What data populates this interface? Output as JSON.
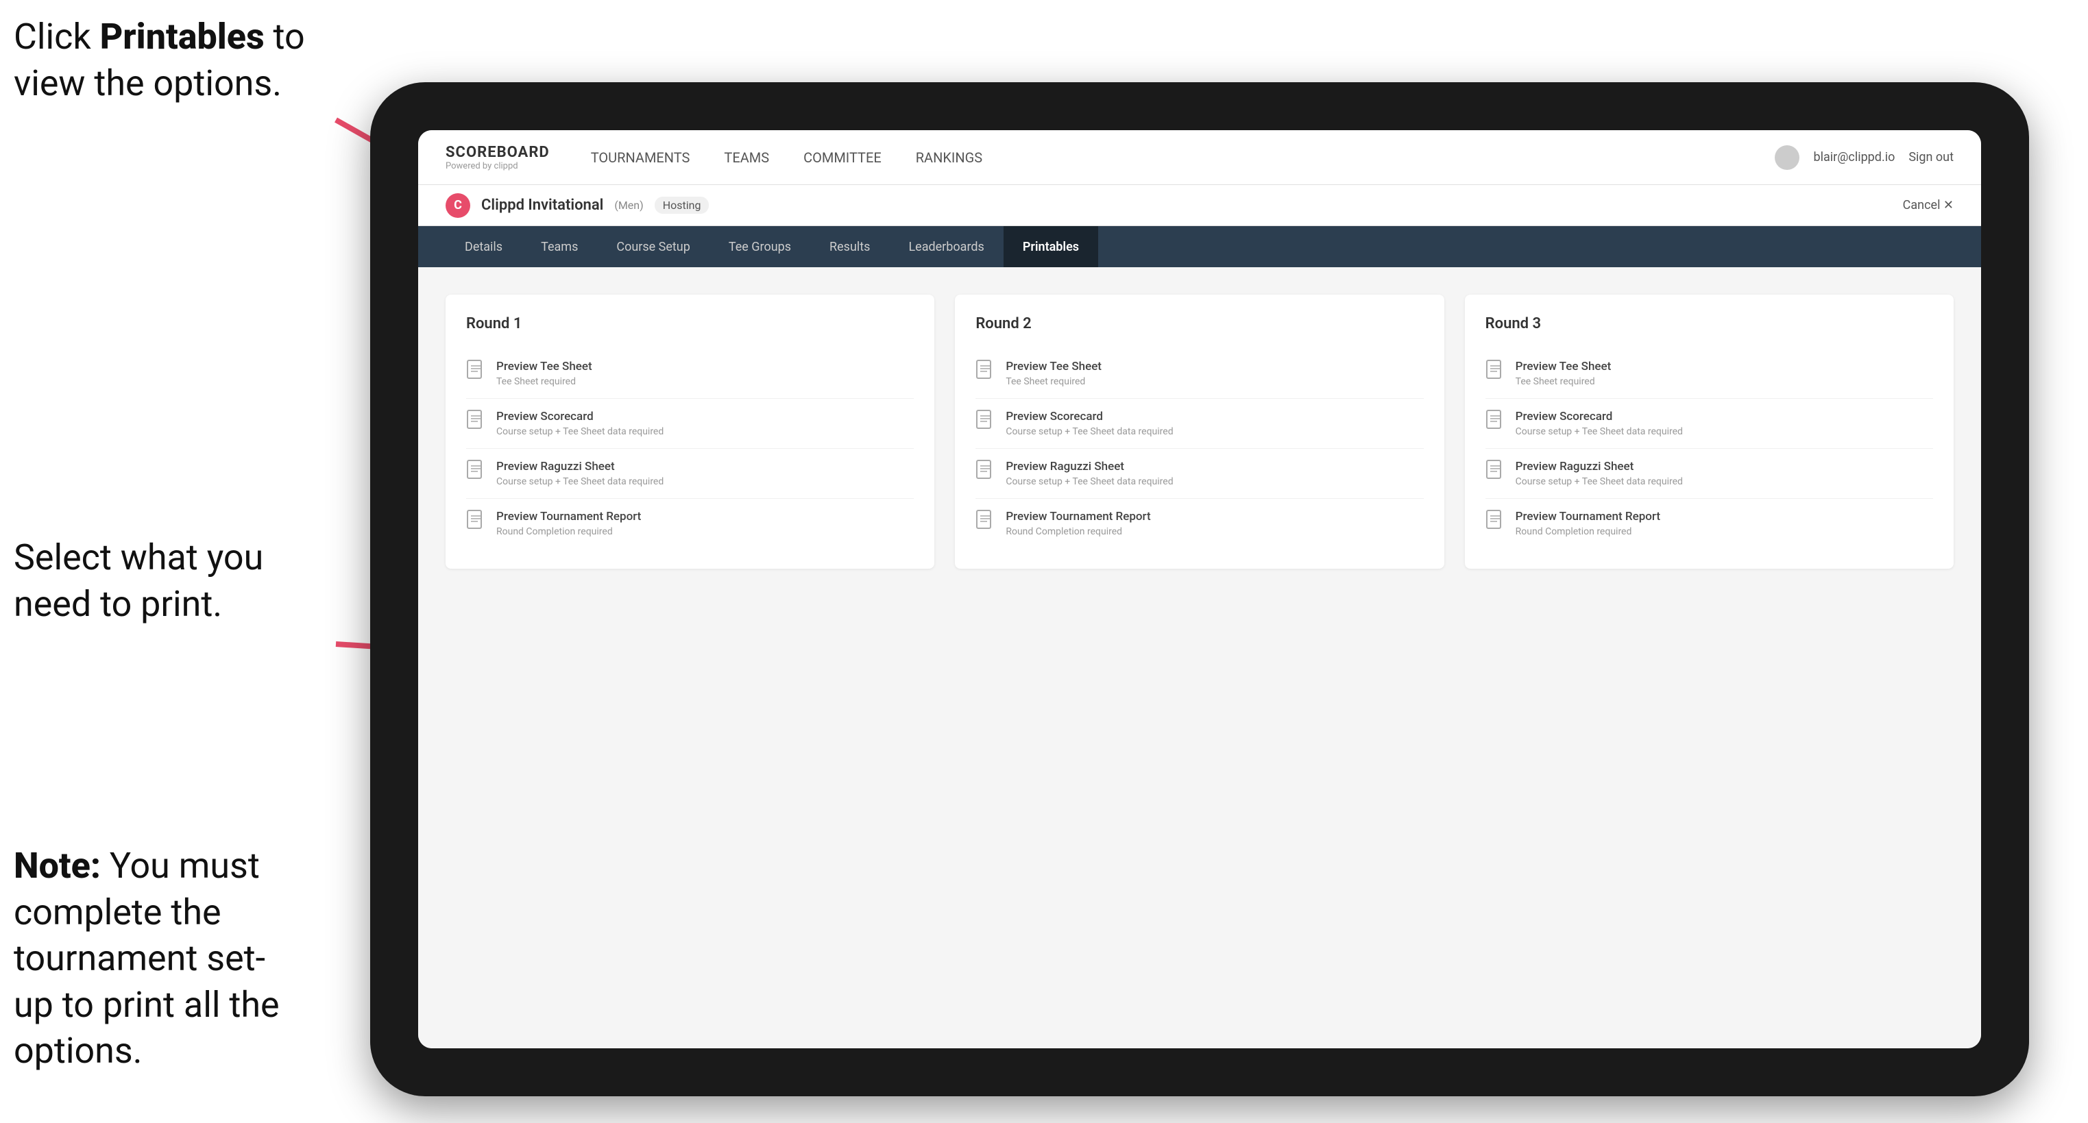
{
  "annotations": {
    "top": {
      "line1_pre": "Click ",
      "line1_bold": "Printables",
      "line1_post": " to",
      "line2": "view the options."
    },
    "middle": {
      "line1": "Select what you",
      "line2": "need to print."
    },
    "bottom": {
      "note_bold": "Note:",
      "note_text": " You must complete the tournament set-up to print all the options."
    }
  },
  "topnav": {
    "logo_title": "SCOREBOARD",
    "logo_sub": "Powered by clippd",
    "links": [
      "TOURNAMENTS",
      "TEAMS",
      "COMMITTEE",
      "RANKINGS"
    ],
    "user_email": "blair@clippd.io",
    "sign_out": "Sign out"
  },
  "breadcrumb": {
    "icon": "C",
    "tournament": "Clippd Invitational",
    "badge": "(Men)",
    "hosting": "Hosting",
    "cancel": "Cancel ✕"
  },
  "subnav": {
    "tabs": [
      "Details",
      "Teams",
      "Course Setup",
      "Tee Groups",
      "Results",
      "Leaderboards",
      "Printables"
    ],
    "active": "Printables"
  },
  "rounds": [
    {
      "title": "Round 1",
      "items": [
        {
          "title": "Preview Tee Sheet",
          "sub": "Tee Sheet required"
        },
        {
          "title": "Preview Scorecard",
          "sub": "Course setup + Tee Sheet data required"
        },
        {
          "title": "Preview Raguzzi Sheet",
          "sub": "Course setup + Tee Sheet data required"
        },
        {
          "title": "Preview Tournament Report",
          "sub": "Round Completion required"
        }
      ]
    },
    {
      "title": "Round 2",
      "items": [
        {
          "title": "Preview Tee Sheet",
          "sub": "Tee Sheet required"
        },
        {
          "title": "Preview Scorecard",
          "sub": "Course setup + Tee Sheet data required"
        },
        {
          "title": "Preview Raguzzi Sheet",
          "sub": "Course setup + Tee Sheet data required"
        },
        {
          "title": "Preview Tournament Report",
          "sub": "Round Completion required"
        }
      ]
    },
    {
      "title": "Round 3",
      "items": [
        {
          "title": "Preview Tee Sheet",
          "sub": "Tee Sheet required"
        },
        {
          "title": "Preview Scorecard",
          "sub": "Course setup + Tee Sheet data required"
        },
        {
          "title": "Preview Raguzzi Sheet",
          "sub": "Course setup + Tee Sheet data required"
        },
        {
          "title": "Preview Tournament Report",
          "sub": "Round Completion required"
        }
      ]
    }
  ]
}
